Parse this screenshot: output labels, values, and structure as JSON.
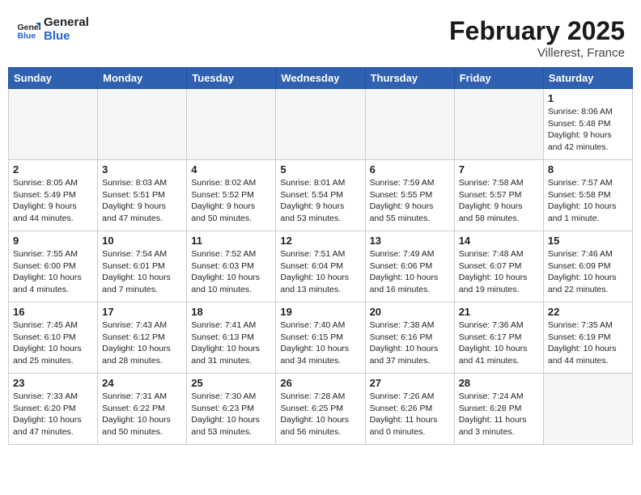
{
  "header": {
    "logo_line1": "General",
    "logo_line2": "Blue",
    "month_year": "February 2025",
    "location": "Villerest, France"
  },
  "days_of_week": [
    "Sunday",
    "Monday",
    "Tuesday",
    "Wednesday",
    "Thursday",
    "Friday",
    "Saturday"
  ],
  "weeks": [
    [
      {
        "day": "",
        "info": ""
      },
      {
        "day": "",
        "info": ""
      },
      {
        "day": "",
        "info": ""
      },
      {
        "day": "",
        "info": ""
      },
      {
        "day": "",
        "info": ""
      },
      {
        "day": "",
        "info": ""
      },
      {
        "day": "1",
        "info": "Sunrise: 8:06 AM\nSunset: 5:48 PM\nDaylight: 9 hours and 42 minutes."
      }
    ],
    [
      {
        "day": "2",
        "info": "Sunrise: 8:05 AM\nSunset: 5:49 PM\nDaylight: 9 hours and 44 minutes."
      },
      {
        "day": "3",
        "info": "Sunrise: 8:03 AM\nSunset: 5:51 PM\nDaylight: 9 hours and 47 minutes."
      },
      {
        "day": "4",
        "info": "Sunrise: 8:02 AM\nSunset: 5:52 PM\nDaylight: 9 hours and 50 minutes."
      },
      {
        "day": "5",
        "info": "Sunrise: 8:01 AM\nSunset: 5:54 PM\nDaylight: 9 hours and 53 minutes."
      },
      {
        "day": "6",
        "info": "Sunrise: 7:59 AM\nSunset: 5:55 PM\nDaylight: 9 hours and 55 minutes."
      },
      {
        "day": "7",
        "info": "Sunrise: 7:58 AM\nSunset: 5:57 PM\nDaylight: 9 hours and 58 minutes."
      },
      {
        "day": "8",
        "info": "Sunrise: 7:57 AM\nSunset: 5:58 PM\nDaylight: 10 hours and 1 minute."
      }
    ],
    [
      {
        "day": "9",
        "info": "Sunrise: 7:55 AM\nSunset: 6:00 PM\nDaylight: 10 hours and 4 minutes."
      },
      {
        "day": "10",
        "info": "Sunrise: 7:54 AM\nSunset: 6:01 PM\nDaylight: 10 hours and 7 minutes."
      },
      {
        "day": "11",
        "info": "Sunrise: 7:52 AM\nSunset: 6:03 PM\nDaylight: 10 hours and 10 minutes."
      },
      {
        "day": "12",
        "info": "Sunrise: 7:51 AM\nSunset: 6:04 PM\nDaylight: 10 hours and 13 minutes."
      },
      {
        "day": "13",
        "info": "Sunrise: 7:49 AM\nSunset: 6:06 PM\nDaylight: 10 hours and 16 minutes."
      },
      {
        "day": "14",
        "info": "Sunrise: 7:48 AM\nSunset: 6:07 PM\nDaylight: 10 hours and 19 minutes."
      },
      {
        "day": "15",
        "info": "Sunrise: 7:46 AM\nSunset: 6:09 PM\nDaylight: 10 hours and 22 minutes."
      }
    ],
    [
      {
        "day": "16",
        "info": "Sunrise: 7:45 AM\nSunset: 6:10 PM\nDaylight: 10 hours and 25 minutes."
      },
      {
        "day": "17",
        "info": "Sunrise: 7:43 AM\nSunset: 6:12 PM\nDaylight: 10 hours and 28 minutes."
      },
      {
        "day": "18",
        "info": "Sunrise: 7:41 AM\nSunset: 6:13 PM\nDaylight: 10 hours and 31 minutes."
      },
      {
        "day": "19",
        "info": "Sunrise: 7:40 AM\nSunset: 6:15 PM\nDaylight: 10 hours and 34 minutes."
      },
      {
        "day": "20",
        "info": "Sunrise: 7:38 AM\nSunset: 6:16 PM\nDaylight: 10 hours and 37 minutes."
      },
      {
        "day": "21",
        "info": "Sunrise: 7:36 AM\nSunset: 6:17 PM\nDaylight: 10 hours and 41 minutes."
      },
      {
        "day": "22",
        "info": "Sunrise: 7:35 AM\nSunset: 6:19 PM\nDaylight: 10 hours and 44 minutes."
      }
    ],
    [
      {
        "day": "23",
        "info": "Sunrise: 7:33 AM\nSunset: 6:20 PM\nDaylight: 10 hours and 47 minutes."
      },
      {
        "day": "24",
        "info": "Sunrise: 7:31 AM\nSunset: 6:22 PM\nDaylight: 10 hours and 50 minutes."
      },
      {
        "day": "25",
        "info": "Sunrise: 7:30 AM\nSunset: 6:23 PM\nDaylight: 10 hours and 53 minutes."
      },
      {
        "day": "26",
        "info": "Sunrise: 7:28 AM\nSunset: 6:25 PM\nDaylight: 10 hours and 56 minutes."
      },
      {
        "day": "27",
        "info": "Sunrise: 7:26 AM\nSunset: 6:26 PM\nDaylight: 11 hours and 0 minutes."
      },
      {
        "day": "28",
        "info": "Sunrise: 7:24 AM\nSunset: 6:28 PM\nDaylight: 11 hours and 3 minutes."
      },
      {
        "day": "",
        "info": ""
      }
    ]
  ]
}
